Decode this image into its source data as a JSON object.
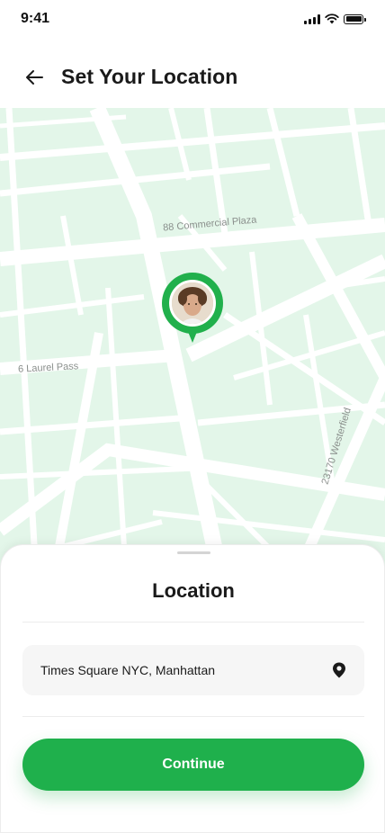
{
  "status_bar": {
    "time": "9:41"
  },
  "header": {
    "title": "Set Your Location",
    "back_icon": "arrow-left-icon"
  },
  "map": {
    "street_labels": [
      "88 Commercial Plaza",
      "6 Laurel Pass",
      "23170 Westerfield"
    ],
    "pin_icon": "location-pin-avatar"
  },
  "sheet": {
    "title": "Location",
    "location_value": "Times Square NYC, Manhattan",
    "location_icon": "map-marker-icon",
    "continue_label": "Continue"
  },
  "colors": {
    "accent": "#1fb04c",
    "map_bg": "#e3f6e9",
    "road": "#ffffff"
  }
}
